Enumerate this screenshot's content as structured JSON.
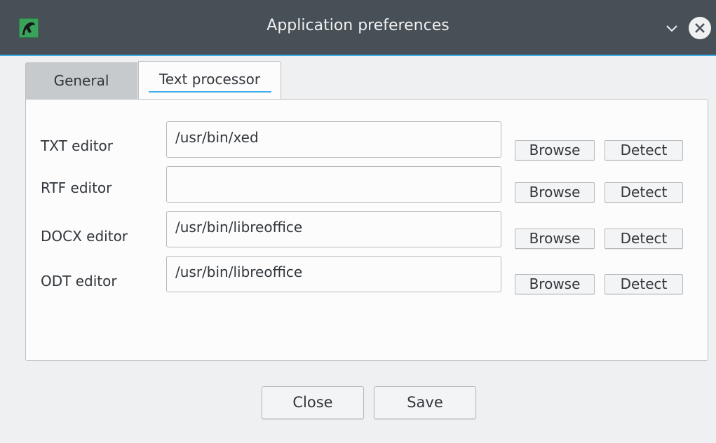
{
  "window": {
    "title": "Application preferences",
    "app_icon": "app-logo-icon",
    "controls": [
      "minimize-icon",
      "close-icon"
    ]
  },
  "tabs": [
    {
      "label": "General",
      "active": false
    },
    {
      "label": "Text processor",
      "active": true
    }
  ],
  "editors": [
    {
      "label": "TXT editor",
      "value": "/usr/bin/xed",
      "browse_label": "Browse",
      "detect_label": "Detect"
    },
    {
      "label": "RTF editor",
      "value": "",
      "browse_label": "Browse",
      "detect_label": "Detect"
    },
    {
      "label": "DOCX editor",
      "value": "/usr/bin/libreoffice",
      "browse_label": "Browse",
      "detect_label": "Detect"
    },
    {
      "label": "ODT editor",
      "value": "/usr/bin/libreoffice",
      "browse_label": "Browse",
      "detect_label": "Detect"
    }
  ],
  "footer": {
    "close_label": "Close",
    "save_label": "Save"
  },
  "colors": {
    "titlebar": "#475057",
    "accent": "#3daee9",
    "window_bg": "#eff0f1",
    "panel_bg": "#fcfcfc"
  }
}
